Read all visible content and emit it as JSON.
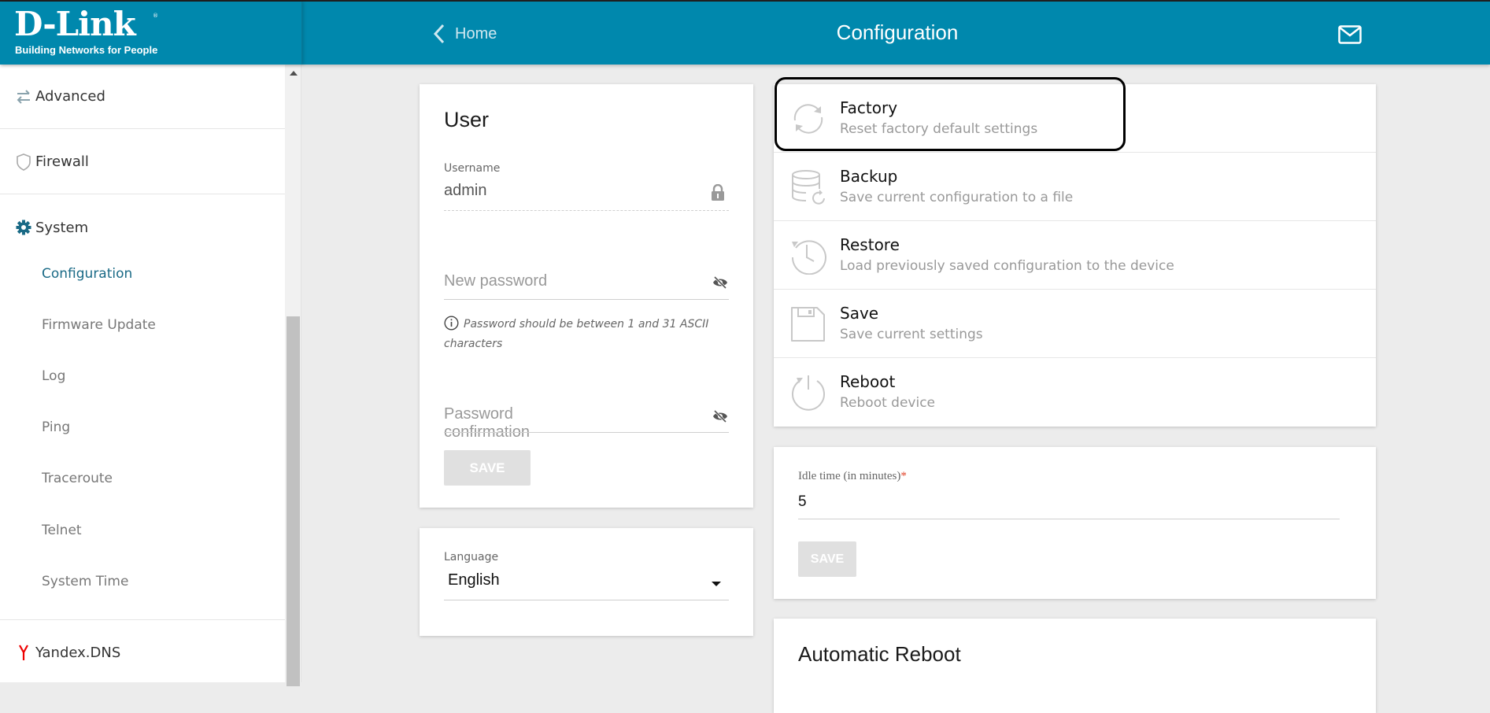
{
  "header": {
    "logo_main": "D-Link",
    "logo_sub": "Building Networks for People",
    "back_label": "Home",
    "title": "Configuration",
    "mail_icon": "mail-icon",
    "brand_color": "#0088ad"
  },
  "sidebar": {
    "sections": [
      {
        "label": "Advanced",
        "icon": "arrows-exchange-icon"
      },
      {
        "label": "Firewall",
        "icon": "shield-icon"
      },
      {
        "label": "System",
        "icon": "gear-icon"
      }
    ],
    "system_items": [
      {
        "label": "Configuration",
        "active": true
      },
      {
        "label": "Firmware Update"
      },
      {
        "label": "Log"
      },
      {
        "label": "Ping"
      },
      {
        "label": "Traceroute"
      },
      {
        "label": "Telnet"
      },
      {
        "label": "System Time"
      }
    ],
    "yandex": {
      "label": "Yandex.DNS",
      "icon": "yandex-icon"
    }
  },
  "user_card": {
    "title": "User",
    "username_label": "Username",
    "username_value": "admin",
    "new_password_placeholder": "New password",
    "hint": "Password should be between 1 and 31 ASCII characters",
    "confirm_placeholder": "Password confirmation",
    "save_label": "SAVE"
  },
  "language_card": {
    "label": "Language",
    "value": "English"
  },
  "actions": [
    {
      "title": "Factory",
      "desc": "Reset factory default settings",
      "icon": "refresh-icon"
    },
    {
      "title": "Backup",
      "desc": "Save current configuration to a file",
      "icon": "database-backup-icon"
    },
    {
      "title": "Restore",
      "desc": "Load previously saved configuration to the device",
      "icon": "history-icon"
    },
    {
      "title": "Save",
      "desc": "Save current settings",
      "icon": "floppy-icon"
    },
    {
      "title": "Reboot",
      "desc": "Reboot device",
      "icon": "power-icon"
    }
  ],
  "idle_card": {
    "label": "Idle time (in minutes)",
    "required_mark": "*",
    "value": "5",
    "save_label": "SAVE"
  },
  "auto_reboot": {
    "title": "Automatic Reboot"
  }
}
